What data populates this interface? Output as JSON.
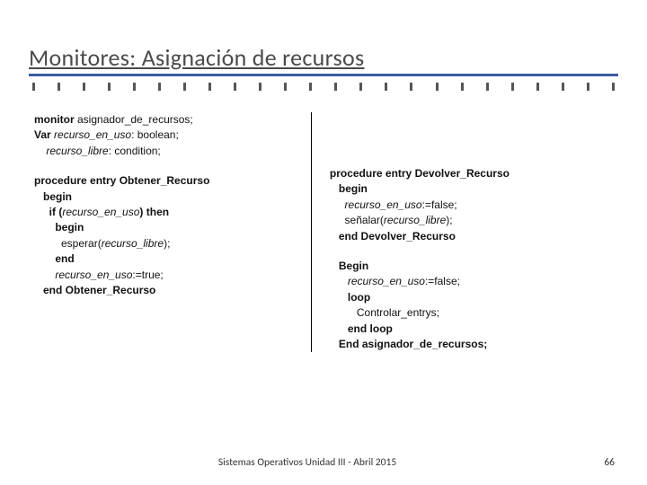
{
  "title": "Monitores: Asignación de recursos",
  "code_left": {
    "l1_kw": "monitor",
    "l1_rest": " asignador_de_recursos;",
    "l2_kw": "Var ",
    "l2_i": "recurso_en_uso",
    "l2_rest": ": boolean;",
    "l3_pad": "    ",
    "l3_i": "recurso_libre",
    "l3_rest": ": condition;",
    "p1_a": "procedure entry ",
    "p1_name": "Obtener_Recurso",
    "p1_begin": "   begin",
    "p1_if_a": "     if (",
    "p1_if_i": "recurso_en_uso",
    "p1_if_b": ") then",
    "p1_b2": "       begin",
    "p1_wait_a": "         esperar(",
    "p1_wait_i": "recurso_libre",
    "p1_wait_b": ");",
    "p1_end1": "       end",
    "p1_set_a": "       ",
    "p1_set_i": "recurso_en_uso",
    "p1_set_b": ":=true;",
    "p1_end2_a": "   end ",
    "p1_end2_name": "Obtener_Recurso"
  },
  "code_right": {
    "p2_a": "procedure entry ",
    "p2_name": "Devolver_Recurso",
    "p2_begin": "   begin",
    "p2_set_a": "     ",
    "p2_set_i": "recurso_en_uso",
    "p2_set_b": ":=false;",
    "p2_sig_a": "     señalar(",
    "p2_sig_i": "recurso_libre",
    "p2_sig_b": ");",
    "p2_end_a": "   end ",
    "p2_end_name": "Devolver_Recurso",
    "m_begin": "   Begin",
    "m_set_a": "      ",
    "m_set_i": "recurso_en_uso",
    "m_set_b": ":=false;",
    "m_loop": "      loop",
    "m_ctrl": "         Controlar_entrys;",
    "m_endloop": "      end loop",
    "m_end": "   End asignador_de_recursos;"
  },
  "footer_center": "Sistemas Operativos    Unidad III -  Abril 2015",
  "page_number": "66"
}
